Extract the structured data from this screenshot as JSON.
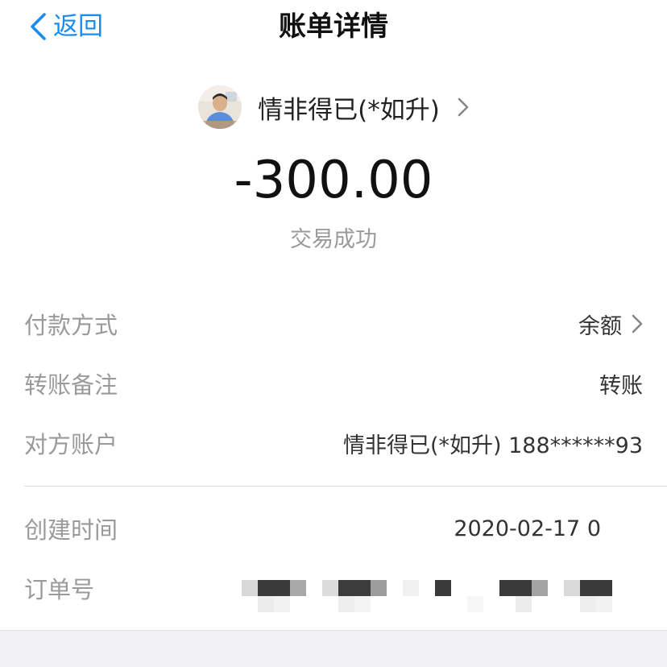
{
  "nav": {
    "back_label": "返回",
    "title": "账单详情"
  },
  "counterparty": {
    "name": "情非得已(*如升)"
  },
  "transaction": {
    "amount": "-300.00",
    "status": "交易成功"
  },
  "details": {
    "payment_method_label": "付款方式",
    "payment_method_value": "余额",
    "note_label": "转账备注",
    "note_value": "转账",
    "account_label": "对方账户",
    "account_value": "情非得已(*如升) 188******93",
    "created_label": "创建时间",
    "created_value": "2020-02-17 0",
    "order_label": "订单号"
  },
  "colors": {
    "accent": "#1a8cf0",
    "muted_text": "#9a9a9a",
    "divider": "#dcdcdc"
  },
  "icons": {
    "back": "chevron-left-icon",
    "party_arrow": "chevron-right-icon",
    "method_arrow": "chevron-right-icon"
  }
}
